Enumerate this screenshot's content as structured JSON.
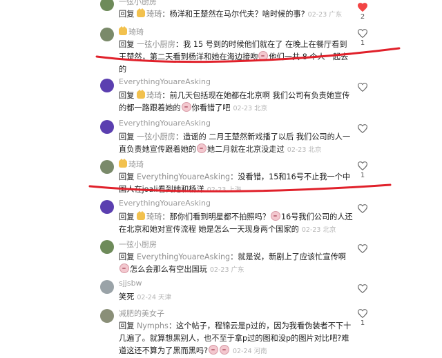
{
  "reply_word": "回复",
  "comments": [
    {
      "user": "一弦小厨房",
      "avatar_color": "#6e8b5a",
      "text_parts": [
        {
          "t": "回复 ",
          "cls": "reply-word"
        },
        {
          "badge": true
        },
        {
          "t": "琦琦",
          "cls": "target"
        },
        {
          "t": "：杨洋和王楚然在马尔代夫？啥时候的事?",
          "cls": ""
        }
      ],
      "date": "02-23",
      "location": "广东",
      "likes": "2",
      "liked": true
    },
    {
      "user": "琦琦",
      "user_badge": true,
      "avatar_color": "#7a8a6a",
      "text_parts": [
        {
          "t": "回复 ",
          "cls": "reply-word"
        },
        {
          "t": "一弦小厨房",
          "cls": "target"
        },
        {
          "t": "：我 15 号到的时候他们就在了 在晚上在餐厅看到王楚然，第二天看到杨洋和她在海边接吻",
          "cls": ""
        },
        {
          "emoji": true
        },
        {
          "t": "他们一共 8 个人一起去的",
          "cls": ""
        }
      ],
      "date": "",
      "location": "",
      "likes": "1",
      "liked": false
    },
    {
      "user": "EverythingYouareAsking",
      "avatar_color": "#5b3fb0",
      "text_parts": [
        {
          "t": "回复 ",
          "cls": "reply-word"
        },
        {
          "badge": true
        },
        {
          "t": "琦琦",
          "cls": "target"
        },
        {
          "t": "：前几天包括现在她都在北京啊 我们公司有负责她宣传的都一路跟着她的",
          "cls": ""
        },
        {
          "emoji": true
        },
        {
          "t": "你看错了吧",
          "cls": ""
        }
      ],
      "date": "02-23",
      "location": "北京",
      "likes": "",
      "liked": false
    },
    {
      "user": "EverythingYouareAsking",
      "avatar_color": "#5b3fb0",
      "text_parts": [
        {
          "t": "回复 ",
          "cls": "reply-word"
        },
        {
          "t": "一弦小厨房",
          "cls": "target"
        },
        {
          "t": "：造谣的 二月王楚然新戏播了以后 我们公司的人一直负责她宣传跟着她的",
          "cls": ""
        },
        {
          "emoji": true
        },
        {
          "t": "她二月就在北京没走过",
          "cls": ""
        }
      ],
      "date": "02-23",
      "location": "北京",
      "likes": "",
      "liked": false
    },
    {
      "user": "琦琦",
      "user_badge": true,
      "avatar_color": "#7a8a6a",
      "text_parts": [
        {
          "t": "回复 ",
          "cls": "reply-word"
        },
        {
          "t": "EverythingYouareAsking",
          "cls": "target"
        },
        {
          "t": "：没看错，15和16号不止我一个中国人在joali看到她和杨洋",
          "cls": ""
        }
      ],
      "date": "02-23",
      "location": "上海",
      "likes": "1",
      "liked": false
    },
    {
      "user": "EverythingYouareAsking",
      "avatar_color": "#5b3fb0",
      "text_parts": [
        {
          "t": "回复 ",
          "cls": "reply-word"
        },
        {
          "badge": true
        },
        {
          "t": "琦琦",
          "cls": "target"
        },
        {
          "t": "：那你们看到明星都不拍照吗？",
          "cls": ""
        },
        {
          "emoji": true
        },
        {
          "t": "16号我们公司的人还在北京和她对宣传流程 她是怎么一天现身两个国家的",
          "cls": ""
        }
      ],
      "date": "02-23",
      "location": "北京",
      "likes": "",
      "liked": false
    },
    {
      "user": "一弦小厨房",
      "avatar_color": "#6e8b5a",
      "text_parts": [
        {
          "t": "回复 ",
          "cls": "reply-word"
        },
        {
          "t": "EverythingYouareAsking",
          "cls": "target"
        },
        {
          "t": "：就是说，新剧上了应该忙宣传啊",
          "cls": ""
        },
        {
          "emoji": true
        },
        {
          "t": "怎么会那么有空出国玩",
          "cls": ""
        }
      ],
      "date": "02-23",
      "location": "广东",
      "likes": "",
      "liked": false
    },
    {
      "user": "sjjsbw",
      "avatar_color": "#9aa3a8",
      "text_parts": [
        {
          "t": "笑死",
          "cls": ""
        }
      ],
      "date": "02-24",
      "location": "天津",
      "likes": "",
      "liked": false
    },
    {
      "user": "减肥的美女子",
      "avatar_color": "#8a8f78",
      "text_parts": [
        {
          "t": "回复 ",
          "cls": "reply-word"
        },
        {
          "t": "Nymphs",
          "cls": "target"
        },
        {
          "t": "：这个帖子，程锦云是p过的，因为我看伪装者不下十几遍了。就算想黑别人，也不至于拿p过的图和没p的图片对比吧?难道这还不算为了黑而黑吗?",
          "cls": ""
        },
        {
          "emoji": true
        },
        {
          "emoji": true
        }
      ],
      "date": "02-24",
      "location": "河南",
      "likes": "1",
      "liked": false
    }
  ]
}
